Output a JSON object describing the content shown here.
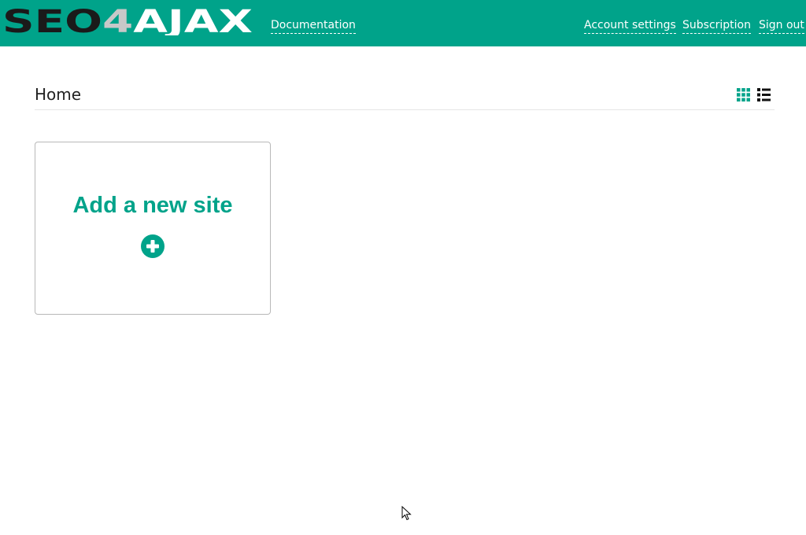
{
  "brand": {
    "logo_text": "SEO4AJAX",
    "color": "#00a38a"
  },
  "header": {
    "nav": {
      "documentation": "Documentation",
      "account_settings": "Account settings",
      "subscription": "Subscription",
      "sign_out": "Sign out"
    }
  },
  "main": {
    "title": "Home",
    "view_toggles": [
      {
        "icon": "grid-view-icon",
        "active": true
      },
      {
        "icon": "list-view-icon",
        "active": false
      }
    ],
    "add_card": {
      "label": "Add a new site",
      "icon": "plus-circle-icon"
    }
  },
  "colors": {
    "accent": "#00a38a",
    "logo_dark": "#1a1a1a",
    "logo_silver": "#c8c8c8",
    "text": "#222222",
    "divider": "#e6e6e6"
  }
}
